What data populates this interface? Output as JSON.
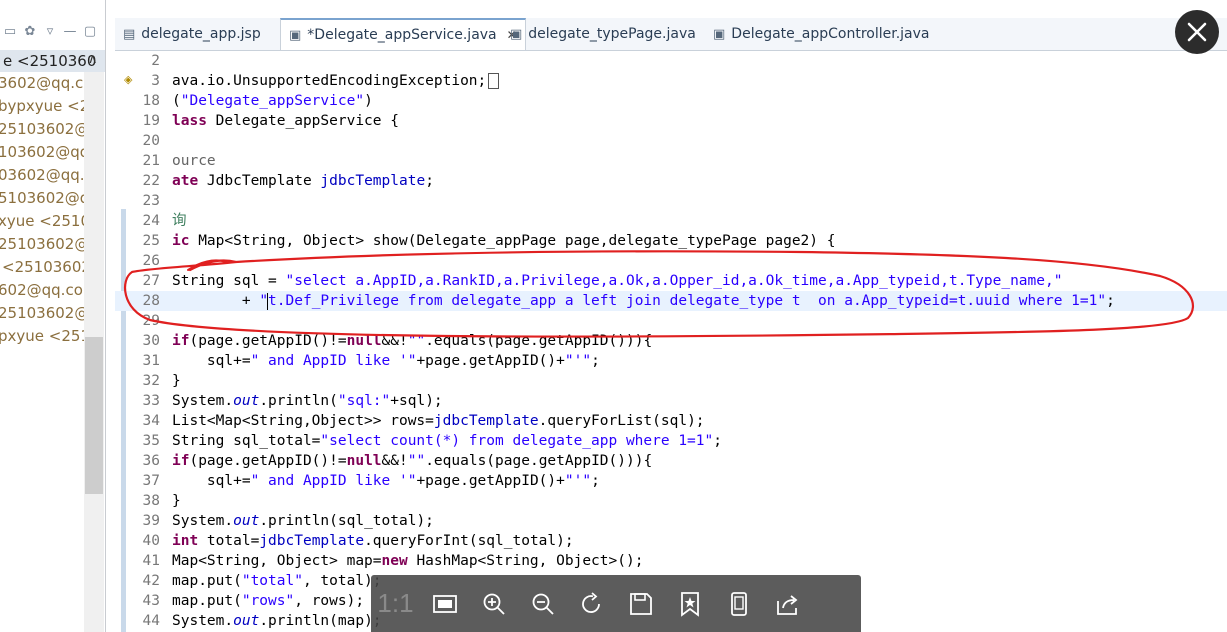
{
  "left_panel": {
    "header": "e <2510360",
    "contacts": [
      "3602@qq.c",
      "bypxyue <2",
      "25103602@c",
      "103602@qq",
      "03602@qq.",
      "5103602@q",
      "xyue <2510",
      "25103602@",
      "<25103602",
      "602@qq.co",
      "25103602@",
      "pxyue <251"
    ]
  },
  "tabs": [
    {
      "label": "delegate_app.jsp",
      "icon": "jsp-file-icon"
    },
    {
      "label": "*Delegate_appService.java",
      "icon": "java-file-icon",
      "active": true
    },
    {
      "label": "delegate_typePage.java",
      "icon": "java-file-icon"
    },
    {
      "label": "Delegate_appController.java",
      "icon": "java-file-icon"
    }
  ],
  "editor": {
    "line_numbers": [
      "2",
      "3",
      "18",
      "19",
      "20",
      "21",
      "22",
      "23",
      "24",
      "25",
      "26",
      "27",
      "28",
      "29",
      "30",
      "31",
      "32",
      "33",
      "34",
      "35",
      "36",
      "37",
      "38",
      "39",
      "40",
      "41",
      "42",
      "43",
      "44"
    ],
    "code": {
      "l3": "ava.io.UnsupportedEncodingException;",
      "l18a": "(",
      "l18b": "\"Delegate_appService\"",
      "l18c": ")",
      "l19a": "lass",
      "l19b": " Delegate_appService {",
      "l21": "ource",
      "l22a": "ate",
      "l22b": " JdbcTemplate ",
      "l22c": "jdbcTemplate",
      "l22d": ";",
      "l24": "询",
      "l25a": "ic",
      "l25b": " Map<String, Object> show(Delegate_appPage page,delegate_typePage page2) {",
      "l27a": "String sql = ",
      "l27b": "\"select a.AppID,a.RankID,a.Privilege,a.Ok,a.Opper_id,a.Ok_time,a.App_typeid,t.Type_name,\"",
      "l28a": "        + ",
      "l28b": "\"",
      "l28c": "t.Def_Privilege from delegate_app a left join delegate_type t  on a.App_typeid=t.uuid where 1=1\"",
      "l28d": ";",
      "l30a": "if",
      "l30b": "(page.getAppID()!=",
      "l30c": "null",
      "l30d": "&&!",
      "l30e": "\"\"",
      "l30f": ".equals(page.getAppID())){",
      "l31a": "    sql+=",
      "l31b": "\" and AppID like '\"",
      "l31c": "+page.getAppID()+",
      "l31d": "\"'\"",
      "l31e": ";",
      "l32": "}",
      "l33a": "System.",
      "l33b": "out",
      "l33c": ".println(",
      "l33d": "\"sql:\"",
      "l33e": "+sql);",
      "l34a": "List<Map<String,Object>> rows=",
      "l34b": "jdbcTemplate",
      "l34c": ".queryForList(sql);",
      "l35a": "String sql_total=",
      "l35b": "\"select count(*) from delegate_app where 1=1\"",
      "l35c": ";",
      "l36a": "if",
      "l36b": "(page.getAppID()!=",
      "l36c": "null",
      "l36d": "&&!",
      "l36e": "\"\"",
      "l36f": ".equals(page.getAppID())){",
      "l37a": "    sql+=",
      "l37b": "\" and AppID like '\"",
      "l37c": "+page.getAppID()+",
      "l37d": "\"'\"",
      "l37e": ";",
      "l38": "}",
      "l39a": "System.",
      "l39b": "out",
      "l39c": ".println(sql_total);",
      "l40a": "int",
      "l40b": " total=",
      "l40c": "jdbcTemplate",
      "l40d": ".queryForInt(sql_total);",
      "l41a": "Map<String, Object> map=",
      "l41b": "new",
      "l41c": " HashMap<String, Object>();",
      "l42a": "map.put(",
      "l42b": "\"total\"",
      "l42c": ", total);",
      "l43a": "map.put(",
      "l43b": "\"rows\"",
      "l43c": ", rows);",
      "l44a": "System.",
      "l44b": "out",
      "l44c": ".println(map);"
    }
  },
  "viewer_toolbar": {
    "actual_size_label": "1:1",
    "buttons": [
      "fit-screen-icon",
      "zoom-in-icon",
      "zoom-out-icon",
      "rotate-icon",
      "save-icon",
      "bookmark-icon",
      "phone-icon",
      "share-icon"
    ]
  },
  "colors": {
    "keyword": "#7f0055",
    "string": "#2a00ff",
    "field": "#0000c0",
    "annotation_stroke": "#e02020",
    "current_line": "#e8f2fe"
  }
}
